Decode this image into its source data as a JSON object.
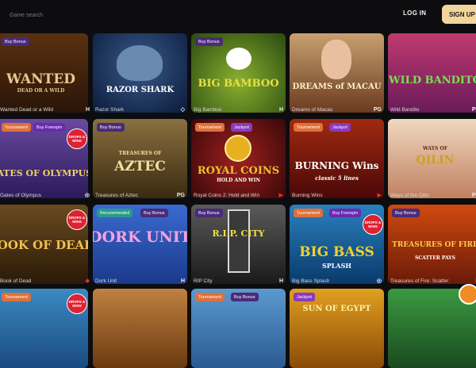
{
  "topbar": {
    "search_placeholder": "Game search",
    "login_label": "LOG IN",
    "signup_label": "SIGN UP"
  },
  "tags": {
    "buy_bonus": "Buy Bonus",
    "tournament": "Tournament",
    "buy_freespin": "Buy Freespin",
    "jackpot": "Jackpot",
    "recommended": "Recommended"
  },
  "badge_text": "DROPS & WINS",
  "games": [
    {
      "caption": "Wanted Dead or a Wild",
      "art_title": "WANTED",
      "art_sub": "DEAD OR A WILD",
      "provider_icon": "H"
    },
    {
      "caption": "Razor Shark",
      "art_title": "RAZOR SHARK",
      "art_sub": "",
      "provider_icon": "◇"
    },
    {
      "caption": "Big Bamboo",
      "art_title": "BIG BAMBOO",
      "art_sub": "",
      "provider_icon": "H"
    },
    {
      "caption": "Dreams of Macau",
      "art_title": "DREAMS of MACAU",
      "art_sub": "",
      "provider_icon": "PG"
    },
    {
      "caption": "Wild Bandito",
      "art_title": "WILD BANDITO",
      "art_sub": "",
      "provider_icon": "PG"
    },
    {
      "caption": "Gates of Olympus",
      "art_title": "GATES OF OLYMPUS",
      "art_sub": "",
      "provider_icon": "◎"
    },
    {
      "caption": "Treasures of Aztec",
      "art_title": "AZTEC",
      "art_sub": "TREASURES OF",
      "provider_icon": "PG"
    },
    {
      "caption": "Royal Coins 2: Hold and Win",
      "art_title": "ROYAL COINS",
      "art_sub": "HOLD AND WIN",
      "provider_icon": "▶"
    },
    {
      "caption": "Burning Wins",
      "art_title": "BURNING Wins",
      "art_sub": "classic 5 lines",
      "provider_icon": "▶"
    },
    {
      "caption": "Ways of the Qilin",
      "art_title": "QILIN",
      "art_sub": "WAYS OF",
      "provider_icon": "PG"
    },
    {
      "caption": "Book of Dead",
      "art_title": "BOOK OF DEAD",
      "art_sub": "",
      "provider_icon": "◆"
    },
    {
      "caption": "Dork Unit",
      "art_title": "DORK UNIT",
      "art_sub": "",
      "provider_icon": "H"
    },
    {
      "caption": "RIP City",
      "art_title": "R.I.P. CITY",
      "art_sub": "",
      "provider_icon": "H"
    },
    {
      "caption": "Big Bass Splash",
      "art_title": "BIG BASS",
      "art_sub": "SPLASH",
      "provider_icon": "◎"
    },
    {
      "caption": "Treasures of Fire: Scatter",
      "art_title": "TREASURES OF FIRE",
      "art_sub": "SCATTER PAYS",
      "provider_icon": "▶"
    },
    {
      "caption": "",
      "art_title": "",
      "art_sub": "",
      "provider_icon": ""
    },
    {
      "caption": "",
      "art_title": "",
      "art_sub": "",
      "provider_icon": ""
    },
    {
      "caption": "",
      "art_title": "",
      "art_sub": "",
      "provider_icon": ""
    },
    {
      "caption": "",
      "art_title": "SUN OF EGYPT",
      "art_sub": "",
      "provider_icon": ""
    },
    {
      "caption": "",
      "art_title": "",
      "art_sub": "",
      "provider_icon": ""
    }
  ],
  "colors": {
    "accent": "#f2d59b",
    "background": "#0d0d0f"
  }
}
